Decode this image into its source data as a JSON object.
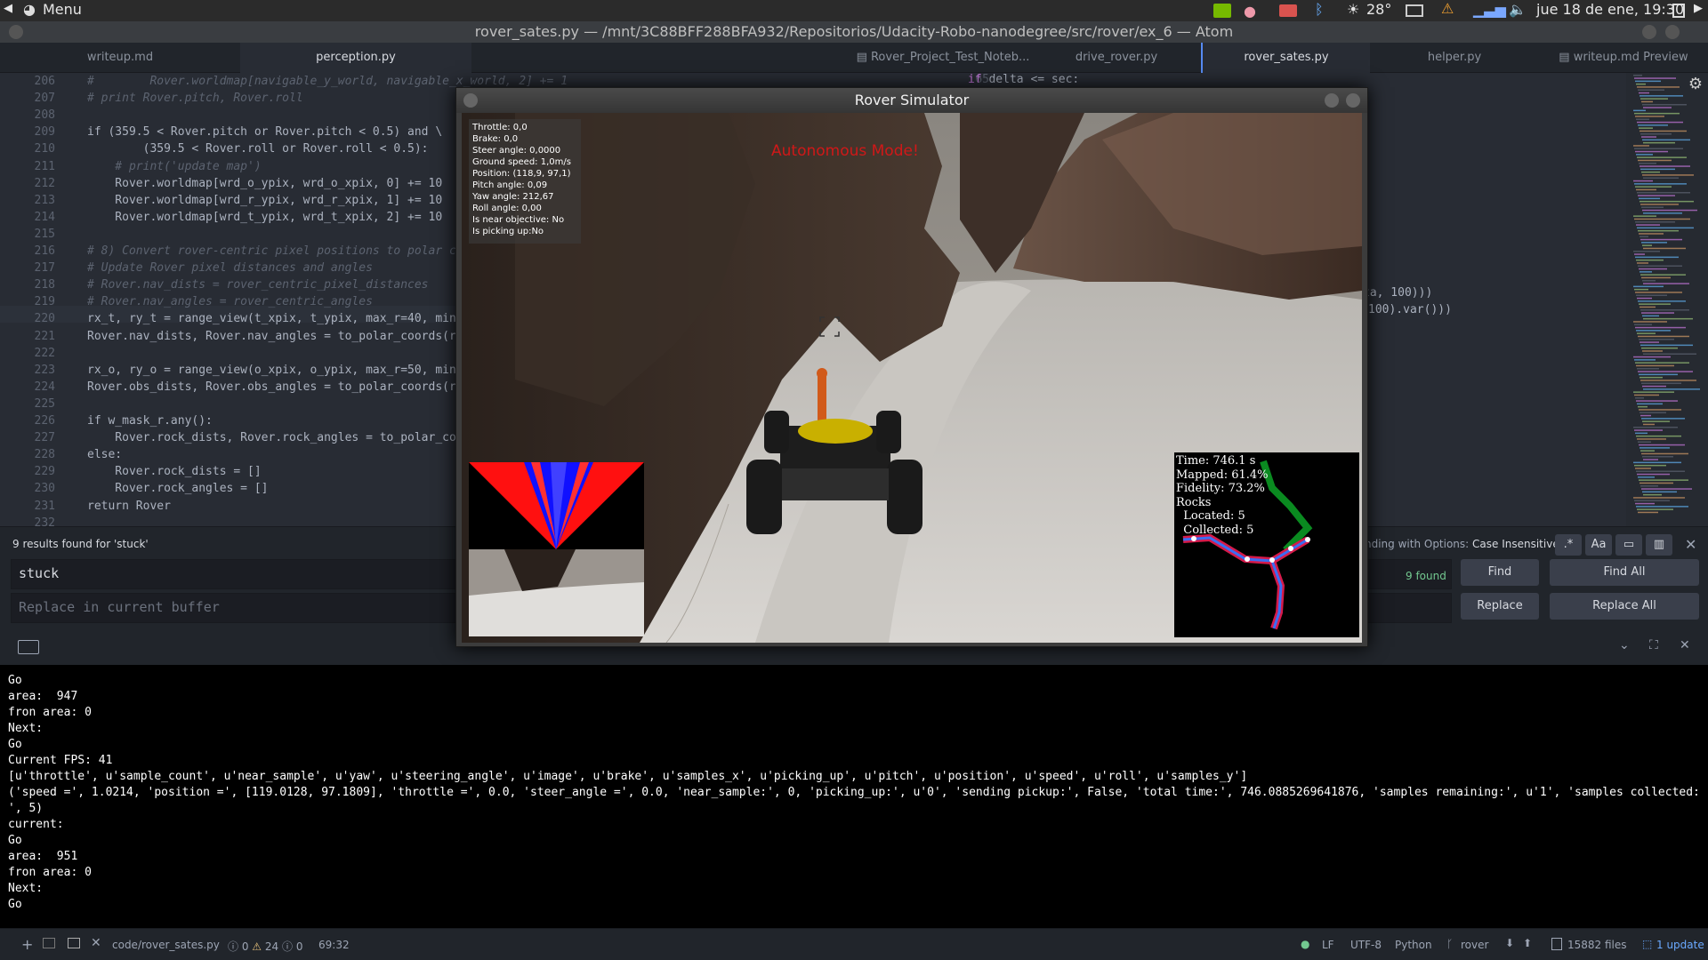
{
  "panel": {
    "menu": "Menu",
    "temp": "28°",
    "datetime": "jue 18 de ene, 19:30"
  },
  "window_title": "rover_sates.py — /mnt/3C88BFF288BFA932/Repositorios/Udacity-Robo-nanodegree/src/rover/ex_6 — Atom",
  "tabs_left": [
    "writeup.md",
    "perception.py"
  ],
  "tabs_right": [
    "Rover_Project_Test_Noteb...",
    "drive_rover.py",
    "rover_sates.py",
    "helper.py",
    "writeup.md Preview"
  ],
  "code_lines": [
    {
      "n": "206",
      "t": "#        Rover.worldmap[navigable_y_world, navigable_x_world, 2] += 1"
    },
    {
      "n": "207",
      "t": "# print Rover.pitch, Rover.roll"
    },
    {
      "n": "208",
      "t": ""
    },
    {
      "n": "209",
      "t": "if (359.5 < Rover.pitch or Rover.pitch < 0.5) and \\"
    },
    {
      "n": "210",
      "t": "        (359.5 < Rover.roll or Rover.roll < 0.5):"
    },
    {
      "n": "211",
      "t": "    # print('update map')"
    },
    {
      "n": "212",
      "t": "    Rover.worldmap[wrd_o_ypix, wrd_o_xpix, 0] += 10"
    },
    {
      "n": "213",
      "t": "    Rover.worldmap[wrd_r_ypix, wrd_r_xpix, 1] += 10"
    },
    {
      "n": "214",
      "t": "    Rover.worldmap[wrd_t_ypix, wrd_t_xpix, 2] += 10"
    },
    {
      "n": "215",
      "t": ""
    },
    {
      "n": "216",
      "t": "# 8) Convert rover-centric pixel positions to polar c"
    },
    {
      "n": "217",
      "t": "# Update Rover pixel distances and angles"
    },
    {
      "n": "218",
      "t": "# Rover.nav_dists = rover_centric_pixel_distances"
    },
    {
      "n": "219",
      "t": "# Rover.nav_angles = rover_centric_angles"
    },
    {
      "n": "220",
      "t": "rx_t, ry_t = range_view(t_xpix, t_ypix, max_r=40, min"
    },
    {
      "n": "221",
      "t": "Rover.nav_dists, Rover.nav_angles = to_polar_coords(r"
    },
    {
      "n": "222",
      "t": ""
    },
    {
      "n": "223",
      "t": "rx_o, ry_o = range_view(o_xpix, o_ypix, max_r=50, min"
    },
    {
      "n": "224",
      "t": "Rover.obs_dists, Rover.obs_angles = to_polar_coords(r"
    },
    {
      "n": "225",
      "t": ""
    },
    {
      "n": "226",
      "t": "if w_mask_r.any():"
    },
    {
      "n": "227",
      "t": "    Rover.rock_dists, Rover.rock_angles = to_polar_co"
    },
    {
      "n": "228",
      "t": "else:"
    },
    {
      "n": "229",
      "t": "    Rover.rock_dists = []"
    },
    {
      "n": "230",
      "t": "    Rover.rock_angles = []"
    },
    {
      "n": "231",
      "t": "return Rover"
    },
    {
      "n": "232",
      "t": ""
    }
  ],
  "right_code": {
    "l65": "65",
    "t65": "if delta <= sec:",
    "frag1": "ta, 100)))",
    "frag2": "100).var()))"
  },
  "find": {
    "summary": "9 results found for 'stuck'",
    "query": "stuck",
    "replace_placeholder": "Replace in current buffer",
    "options_text": "nding with Options: ",
    "options_value": "Case Insensitive",
    "found": "9 found",
    "find_btn": "Find",
    "find_all_btn": "Find All",
    "replace_btn": "Replace",
    "replace_all_btn": "Replace All",
    "regex_btn": ".*",
    "case_btn": "Aa"
  },
  "sim": {
    "title": "Rover Simulator",
    "mode": "Autonomous Mode!",
    "hud": [
      "Throttle: 0,0",
      "Brake: 0,0",
      "Steer angle: 0,0000",
      "Ground speed: 1,0m/s",
      "Position: (118,9, 97,1)",
      "Pitch angle: 0,09",
      "Yaw angle: 212,67",
      "Roll angle: 0,00",
      "Is near objective: No",
      "Is picking up:No"
    ],
    "map": [
      "Time: 746.1 s",
      "Mapped: 61.4%",
      "Fidelity: 73.2%",
      "Rocks",
      "  Located: 5",
      "  Collected: 5"
    ]
  },
  "terminal": "Go\narea:  947\nfron area: 0\nNext:\nGo\nCurrent FPS: 41\n[u'throttle', u'sample_count', u'near_sample', u'yaw', u'steering_angle', u'image', u'brake', u'samples_x', u'picking_up', u'pitch', u'position', u'speed', u'roll', u'samples_y']\n('speed =', 1.0214, 'position =', [119.0128, 97.1809], 'throttle =', 0.0, 'steer_angle =', 0.0, 'near_sample:', 0, 'picking_up:', u'0', 'sending pickup:', False, 'total time:', 746.0885269641876, 'samples remaining:', u'1', 'samples collected:\n', 5)\ncurrent:\nGo\narea:  951\nfron area: 0\nNext:\nGo",
  "status": {
    "file": "code/rover_sates.py",
    "errors": "0",
    "warnings": "24",
    "infos": "0",
    "cursor": "69:32",
    "eol": "LF",
    "encoding": "UTF-8",
    "grammar": "Python",
    "branch": "rover",
    "files": "15882 files",
    "update": "1 update"
  }
}
